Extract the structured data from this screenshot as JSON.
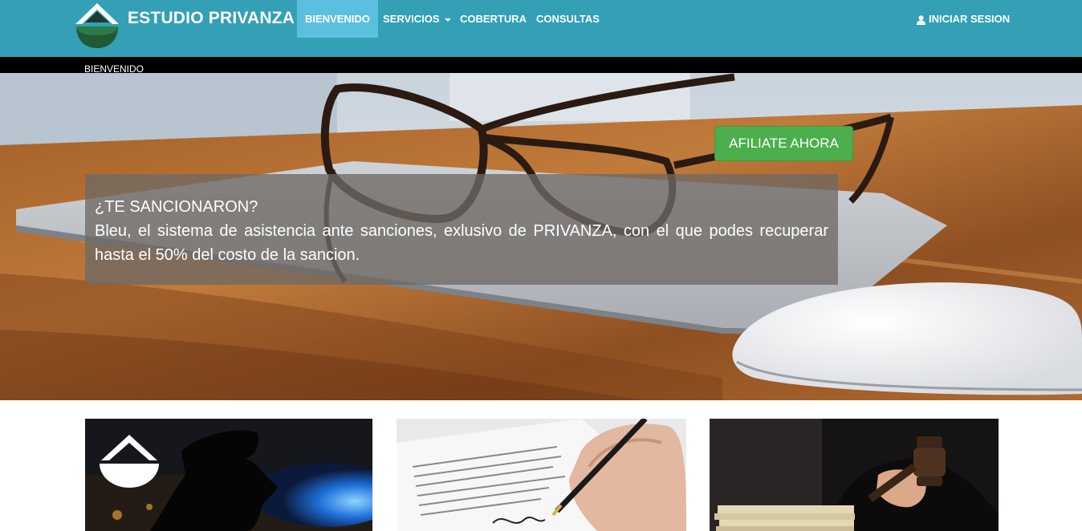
{
  "navbar": {
    "brand": "ESTUDIO PRIVANZA",
    "items": [
      {
        "label": "BIENVENIDO",
        "active": true
      },
      {
        "label": "SERVICIOS",
        "dropdown": true
      },
      {
        "label": "COBERTURA"
      },
      {
        "label": "CONSULTAS"
      }
    ],
    "login": "INICIAR SESION",
    "colors": {
      "bar": "#33a0b6",
      "active": "#5bc0de"
    }
  },
  "breadcrumb": "BIENVENIDO",
  "hero": {
    "cta": "AFILIATE AHORA",
    "caption_title": "¿TE SANCIONARON?",
    "caption_body": "Bleu, el sistema de asistencia ante sanciones, exlusivo de PRIVANZA, con el que podes recuperar hasta el 50% del costo de la sancion."
  },
  "cards": [
    {
      "image": "police-officer-silhouette"
    },
    {
      "image": "signing-document"
    },
    {
      "image": "judge-gavel"
    }
  ]
}
